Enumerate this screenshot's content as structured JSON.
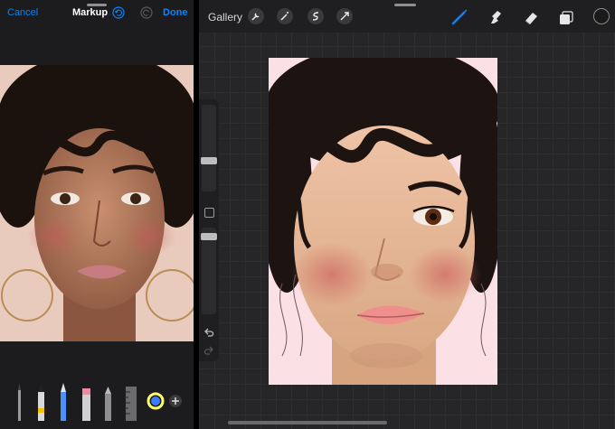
{
  "markup": {
    "cancel_label": "Cancel",
    "title": "Markup",
    "done_label": "Done",
    "undo_icon": "undo-icon",
    "redo_icon": "redo-icon",
    "tools": [
      "pen-icon",
      "marker-icon",
      "pencil-icon",
      "eraser-icon",
      "lasso-icon",
      "ruler-icon",
      "color-picker-icon",
      "add-icon"
    ]
  },
  "procreate": {
    "gallery_label": "Gallery",
    "toolbar_icons": [
      "wrench-icon",
      "magic-wand-icon",
      "selection-icon",
      "transform-arrow-icon"
    ],
    "tool_icons": [
      "brush-icon",
      "smudge-icon",
      "eraser-icon",
      "layers-icon"
    ],
    "color_swatch": "#1a1a1a",
    "accent": "#0a84ff"
  }
}
